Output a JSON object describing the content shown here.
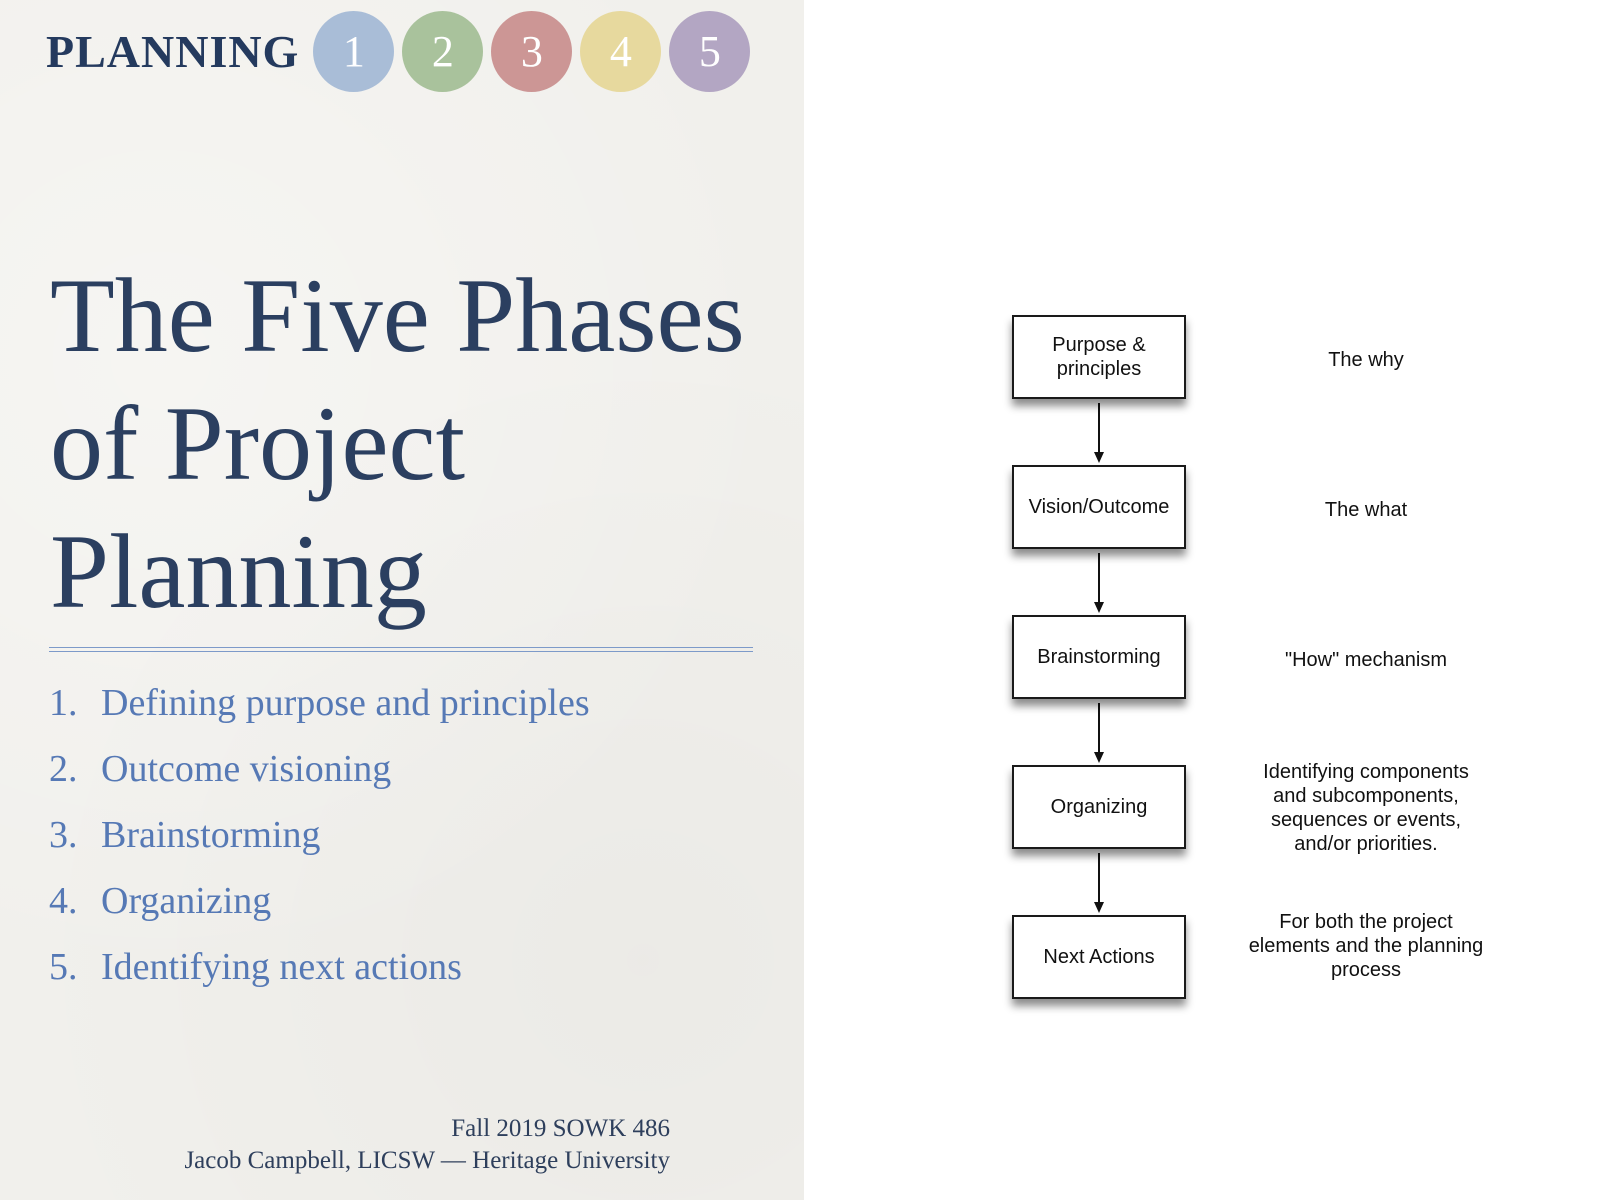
{
  "header": {
    "title": "PLANNING",
    "phase_circles": [
      {
        "label": "1",
        "color": "#a9bdd7"
      },
      {
        "label": "2",
        "color": "#a9c29c"
      },
      {
        "label": "3",
        "color": "#cc9695"
      },
      {
        "label": "4",
        "color": "#e7d99e"
      },
      {
        "label": "5",
        "color": "#b3a6c3"
      }
    ]
  },
  "slide": {
    "title": "The Five Phases of Project Planning",
    "phases": [
      {
        "num": "1.",
        "text": "Defining purpose and principles"
      },
      {
        "num": "2.",
        "text": "Outcome visioning"
      },
      {
        "num": "3.",
        "text": "Brainstorming"
      },
      {
        "num": "4.",
        "text": "Organizing"
      },
      {
        "num": "5.",
        "text": "Identifying next actions"
      }
    ],
    "footer": {
      "course": "Fall 2019 SOWK 486",
      "author": "Jacob Campbell, LICSW — Heritage University"
    }
  },
  "diagram": {
    "steps": [
      {
        "box": "Purpose & principles",
        "description": "The why"
      },
      {
        "box": "Vision/Outcome",
        "description": "The what"
      },
      {
        "box": "Brainstorming",
        "description": "\"How\" mechanism"
      },
      {
        "box": "Organizing",
        "description": "Identifying components and subcomponents, sequences or events, and/or priorities."
      },
      {
        "box": "Next Actions",
        "description": "For both the project elements and the planning process"
      }
    ]
  },
  "colors": {
    "title_navy": "#2b3f60",
    "list_blue": "#5679b5",
    "rule_blue": "#7d9ac9",
    "paper": "#f1f0ec"
  }
}
